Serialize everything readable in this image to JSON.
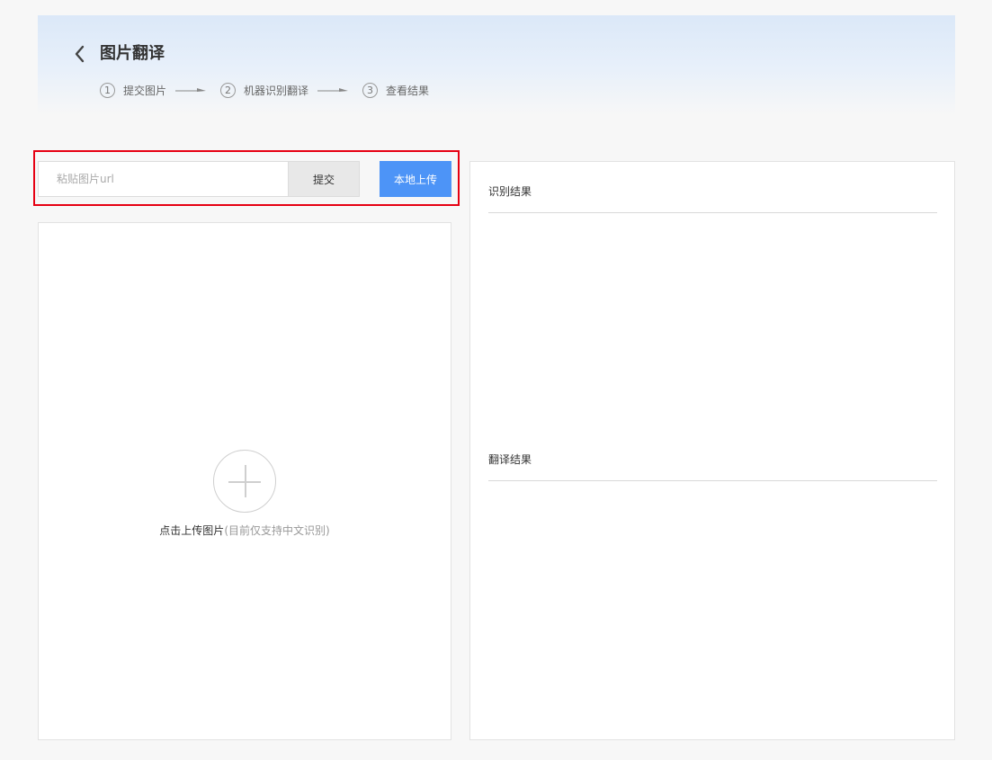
{
  "header": {
    "title": "图片翻译",
    "steps": [
      {
        "number": "1",
        "label": "提交图片"
      },
      {
        "number": "2",
        "label": "机器识别翻译"
      },
      {
        "number": "3",
        "label": "查看结果"
      }
    ]
  },
  "toolbar": {
    "url_placeholder": "粘贴图片url",
    "submit_label": "提交",
    "local_upload_label": "本地上传"
  },
  "upload_area": {
    "main_text": "点击上传图片",
    "sub_text": "(目前仅支持中文识别)"
  },
  "results": {
    "recognition_title": "识别结果",
    "translation_title": "翻译结果"
  },
  "colors": {
    "accent": "#4d94f7",
    "highlight_frame": "#e60012",
    "header_bg": "#dbe8f8"
  }
}
